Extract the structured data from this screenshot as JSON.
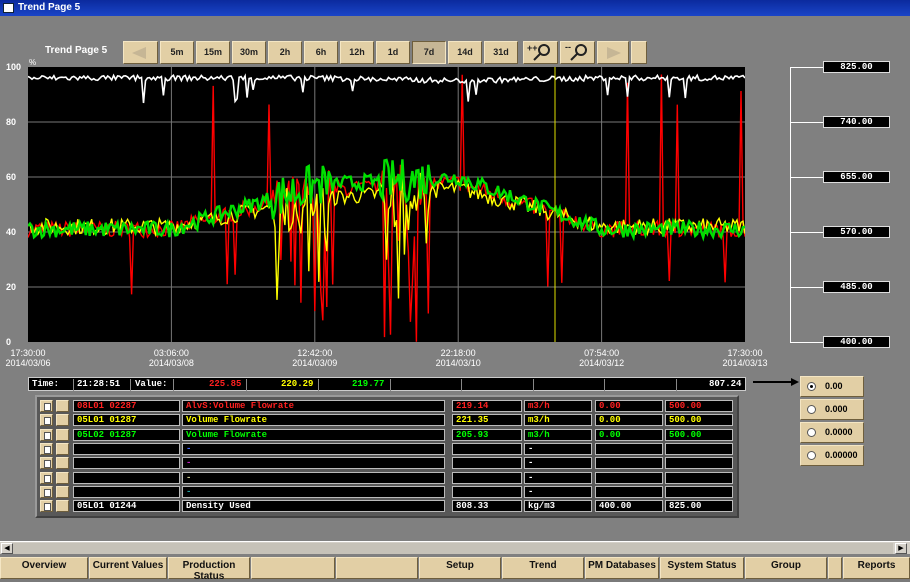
{
  "window": {
    "title": "Trend Page 5"
  },
  "page_title": "Trend Page 5",
  "toolbar": {
    "time_ranges": [
      "5m",
      "15m",
      "30m",
      "2h",
      "6h",
      "12h",
      "1d",
      "7d",
      "14d",
      "31d"
    ],
    "selected_range": "7d",
    "zoom_in": "zoom-in",
    "zoom_out": "zoom-out"
  },
  "chart": {
    "y_unit": "%",
    "y_ticks": [
      "100",
      "80",
      "60",
      "40",
      "20",
      "0"
    ],
    "x_ticks": [
      {
        "time": "17:30:00",
        "date": "2014/03/06"
      },
      {
        "time": "03:06:00",
        "date": "2014/03/08"
      },
      {
        "time": "12:42:00",
        "date": "2014/03/09"
      },
      {
        "time": "22:18:00",
        "date": "2014/03/10"
      },
      {
        "time": "07:54:00",
        "date": "2014/03/12"
      },
      {
        "time": "17:30:00",
        "date": "2014/03/13"
      }
    ],
    "right_scale": [
      "825.00",
      "740.00",
      "655.00",
      "570.00",
      "485.00",
      "400.00"
    ],
    "colors": {
      "series1": "#ff0000",
      "series2": "#ffff00",
      "series3": "#00e000",
      "density": "#ffffff",
      "cursor": "#e0e000"
    }
  },
  "chart_data": {
    "type": "line",
    "x": [
      "2014/03/06 17:30",
      "2014/03/08 03:06",
      "2014/03/09 12:42",
      "2014/03/10 22:18",
      "2014/03/12 07:54",
      "2014/03/13 17:30"
    ],
    "ylim": [
      0,
      100
    ],
    "y_unit": "%",
    "series": [
      {
        "name": "AlvS:Volume Flowrate",
        "color": "#ff0000",
        "values": [
          41,
          41,
          55,
          58,
          41,
          41
        ]
      },
      {
        "name": "Volume Flowrate",
        "color": "#ffff00",
        "values": [
          42,
          42,
          52,
          56,
          42,
          42
        ]
      },
      {
        "name": "Volume Flowrate",
        "color": "#00e000",
        "values": [
          41,
          41,
          57,
          60,
          41,
          41
        ]
      },
      {
        "name": "Density Used",
        "color": "#ffffff",
        "values": [
          96,
          96,
          96,
          95,
          96,
          96
        ]
      }
    ],
    "right_axis": {
      "labels": [
        "825.00",
        "740.00",
        "655.00",
        "570.00",
        "485.00",
        "400.00"
      ],
      "range": [
        400,
        825
      ]
    }
  },
  "readout": {
    "time_label": "Time:",
    "time": "21:28:51",
    "value_label": "Value:",
    "v1": "225.85",
    "v2": "220.29",
    "v3": "219.77",
    "v4": "807.24"
  },
  "formats": [
    "0.00",
    "0.000",
    "0.0000",
    "0.00000"
  ],
  "selected_format": "0.00",
  "tags": [
    {
      "tag": "08L01 02287",
      "desc": "AlvS:Volume Flowrate",
      "value": "219.14",
      "unit": "m3/h",
      "min": "0.00",
      "max": "500.00",
      "color": "#ff2020"
    },
    {
      "tag": "05L01 01287",
      "desc": "Volume Flowrate",
      "value": "221.35",
      "unit": "m3/h",
      "min": "0.00",
      "max": "500.00",
      "color": "#ffff00"
    },
    {
      "tag": "05L02 01287",
      "desc": "Volume Flowrate",
      "value": "205.93",
      "unit": "m3/h",
      "min": "0.00",
      "max": "500.00",
      "color": "#00ff00"
    },
    {
      "tag": "",
      "desc": "-",
      "value": "",
      "unit": "-",
      "min": "",
      "max": "",
      "color": "#4a6aff"
    },
    {
      "tag": "",
      "desc": "-",
      "value": "",
      "unit": "-",
      "min": "",
      "max": "",
      "color": "#c020c0"
    },
    {
      "tag": "",
      "desc": "-",
      "value": "",
      "unit": "-",
      "min": "",
      "max": "",
      "color": "#c8c890"
    },
    {
      "tag": "",
      "desc": "-",
      "value": "",
      "unit": "-",
      "min": "",
      "max": "",
      "color": "#20a0a0"
    },
    {
      "tag": "05L01 01244",
      "desc": "Density Used",
      "value": "808.33",
      "unit": "kg/m3",
      "min": "400.00",
      "max": "825.00",
      "color": "#ffffff"
    }
  ],
  "nav": [
    "Overview",
    "Current Values",
    "Production Status",
    "",
    "",
    "Setup",
    "Trend",
    "PM Databases",
    "System Status",
    "Group",
    "",
    "Reports"
  ]
}
